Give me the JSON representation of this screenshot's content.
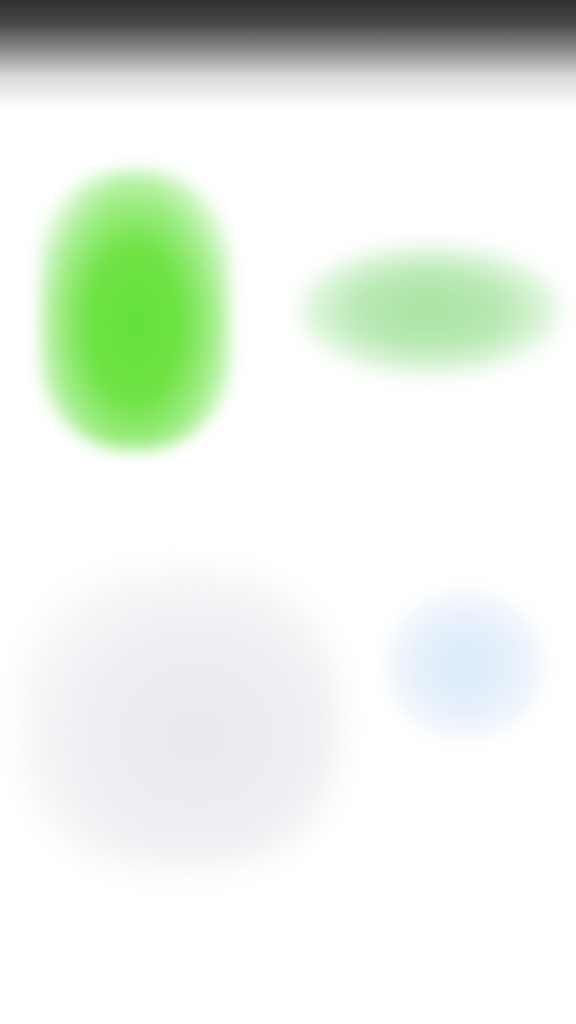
{
  "screen": {
    "status_bar_color": "#2f2f2f",
    "background_color": "#ffffff"
  },
  "content": {
    "primary_tile": {
      "icon": "green-tile",
      "color": "#62e13a"
    },
    "secondary_pill": {
      "icon": "green-pill",
      "color": "#a6e3a0"
    },
    "card": {
      "icon": "grey-card",
      "color": "#e9eaee"
    },
    "action_circle": {
      "icon": "blue-circle",
      "color": "#dcecfb"
    }
  }
}
